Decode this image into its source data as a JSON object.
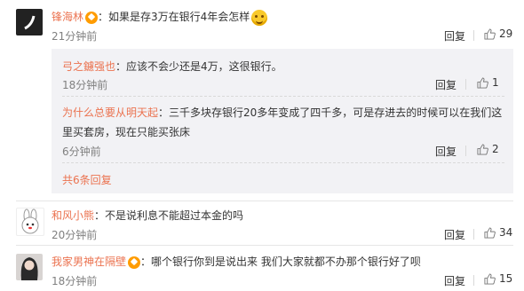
{
  "comments": [
    {
      "user": "锋海林",
      "text": "：如果是存3万在银行4年会怎样",
      "time": "21分钟前",
      "reply_label": "回复",
      "likes": "29",
      "replies": [
        {
          "user": "弓之鑢强也",
          "text": "：应该不会少还是4万，这很银行。",
          "time": "18分钟前",
          "reply_label": "回复",
          "likes": "1"
        },
        {
          "user": "为什么总要从明天起",
          "text": "：三千多块存银行20多年变成了四千多，可是存进去的时候可以在我们这",
          "text2": "里买套房，现在只能买张床",
          "time": "6分钟前",
          "reply_label": "回复",
          "likes": "2"
        }
      ],
      "more_replies": "共6条回复"
    },
    {
      "user": "和风小熊",
      "text": "：不是说利息不能超过本金的吗",
      "time": "20分钟前",
      "reply_label": "回复",
      "likes": "34"
    },
    {
      "user": "我家男神在隔壁",
      "text": "：哪个银行你到是说出来 我们大家就都不办那个银行好了呗",
      "time": "18分钟前",
      "reply_label": "回复",
      "likes": "15"
    }
  ]
}
